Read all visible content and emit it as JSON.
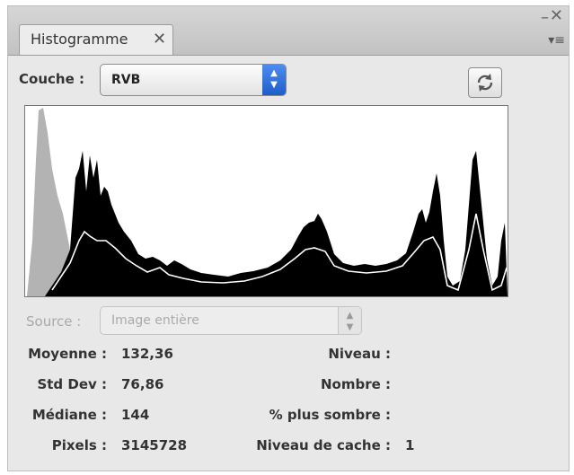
{
  "panel": {
    "tab_label": "Histogramme",
    "tab_close": "✕",
    "window_minimize": "–",
    "window_close": "✕",
    "panel_menu": "▾≡"
  },
  "channel": {
    "label": "Couche :",
    "value": "RVB"
  },
  "source": {
    "label": "Source :",
    "value": "Image entière"
  },
  "stats": {
    "mean_label": "Moyenne :",
    "mean_value": "132,36",
    "stddev_label": "Std Dev :",
    "stddev_value": "76,86",
    "median_label": "Médiane :",
    "median_value": "144",
    "pixels_label": "Pixels :",
    "pixels_value": "3145728",
    "level_label": "Niveau :",
    "count_label": "Nombre :",
    "percentile_label": "% plus sombre :",
    "cache_level_label": "Niveau de cache :",
    "cache_level_value": "1"
  },
  "colors": {
    "accent": "#2f6fd6",
    "histogram_fill": "#000000",
    "gray_channel": "#b3b3b3"
  },
  "icons": {
    "refresh": "refresh-icon"
  }
}
